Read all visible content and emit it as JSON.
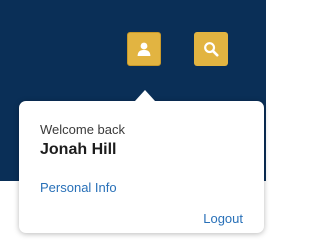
{
  "header": {
    "background": "#0a2f57",
    "user_button": {
      "icon": "user-icon",
      "color": "#e2b441"
    },
    "search_button": {
      "icon": "search-icon",
      "color": "#e2b441"
    }
  },
  "account_popover": {
    "welcome_text": "Welcome back",
    "user_name": "Jonah Hill",
    "personal_info_label": "Personal Info",
    "logout_label": "Logout",
    "link_color": "#2870b8"
  }
}
